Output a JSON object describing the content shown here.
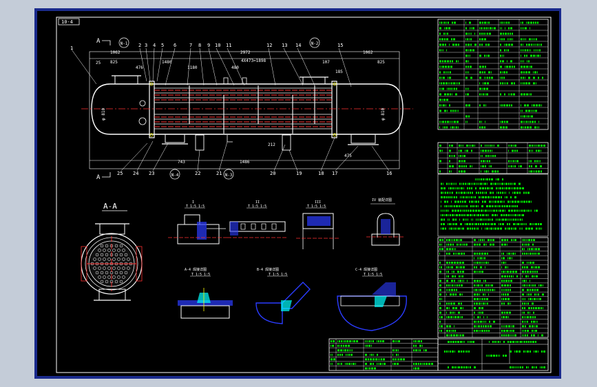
{
  "drawing": {
    "sheet_code": "10-4",
    "section_marks": [
      "A",
      "A"
    ],
    "section_title": "A-A",
    "tube_note": "4X473=1898",
    "dimensions": {
      "overall": "2972",
      "left_top": "1062",
      "right_top": "1062",
      "left_head": "825",
      "right_head": "825",
      "small_left": "476",
      "small_right": "107",
      "upper_a": "1180",
      "upper_b": "1480",
      "upper_c": "480",
      "lower_a": "743",
      "lower_b": "1486",
      "lower_c": "475",
      "lower_d": "212",
      "vert_a": "25",
      "vert_b": "185",
      "dia_l": "φ 810",
      "dia_r": "φ 810"
    },
    "nozzle_labels": [
      "N-1",
      "N-2",
      "N-3",
      "N-4"
    ],
    "part_numbers_top": [
      "1",
      "2",
      "3",
      "4",
      "5",
      "6",
      "7",
      "8",
      "9",
      "10",
      "11",
      "12",
      "13",
      "14",
      "15"
    ],
    "part_numbers_bottom": [
      "25",
      "24",
      "23",
      "22",
      "21",
      "20",
      "19",
      "18",
      "17",
      "16"
    ],
    "details": [
      {
        "title": "I",
        "scale": "T 1:5 1:5"
      },
      {
        "title": "II",
        "scale": "T 1:5 1:5"
      },
      {
        "title": "III",
        "scale": "T 1:5 1:5"
      },
      {
        "title": "IV 装配详图",
        "scale": ""
      },
      {
        "title": "A-4 焊接详图",
        "scale": "T 1:5 1:5"
      },
      {
        "title": "B-4 焊接详图",
        "scale": "T 1:5 1:5"
      },
      {
        "title": "C-4 焊接详图",
        "scale": "T 1:5 1:5"
      }
    ]
  },
  "colors": {
    "background": "#000000",
    "frame": "#ffffff",
    "outer_border": "#1a2a8c",
    "geometry": "#ffffff",
    "centerline": "#ff3030",
    "annotation": "#00ff00",
    "hatch": "#2b3cff",
    "accent_yellow": "#ffff00",
    "accent_cyan": "#00ffff"
  }
}
